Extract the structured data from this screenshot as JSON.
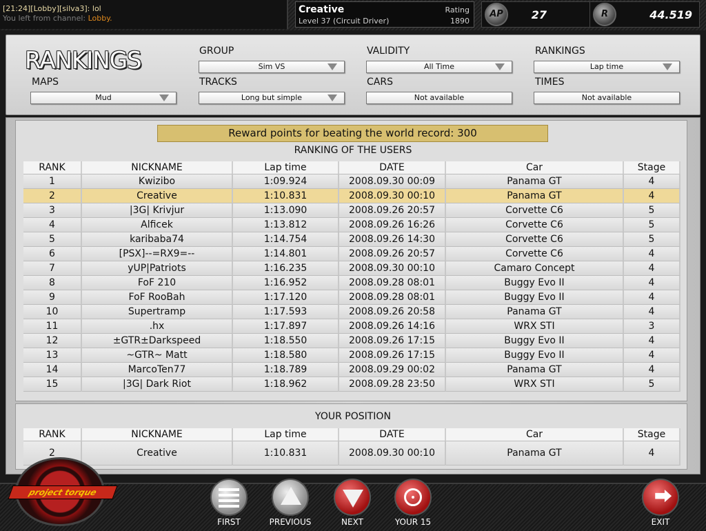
{
  "chat": {
    "line1": "[21:24][Lobby][silva3]: lol",
    "line2_prefix": "You left from channel: ",
    "line2_channel": "Lobby."
  },
  "player": {
    "name": "Creative",
    "level": "Level 37 (Circuit Driver)",
    "rating_label": "Rating",
    "rating_value": "1890"
  },
  "stats": {
    "ap_icon": "ap-coin-icon",
    "ap_label": "AP",
    "ap_value": "27",
    "rp_icon": "rp-coin-icon",
    "rp_label": "R",
    "rp_value": "44.519"
  },
  "page_title": "RANKINGS",
  "filters": {
    "group": {
      "label": "GROUP",
      "value": "Sim VS"
    },
    "validity": {
      "label": "VALIDITY",
      "value": "All Time"
    },
    "rankings": {
      "label": "RANKINGS",
      "value": "Lap time"
    },
    "maps": {
      "label": "MAPS",
      "value": "Mud"
    },
    "tracks": {
      "label": "TRACKS",
      "value": "Long but simple"
    },
    "cars": {
      "label": "CARS",
      "value": "Not available"
    },
    "times": {
      "label": "TIMES",
      "value": "Not available"
    }
  },
  "reward_text": "Reward points for beating the world record: 300",
  "ranking_title": "RANKING OF THE USERS",
  "columns": [
    "RANK",
    "NICKNAME",
    "Lap time",
    "DATE",
    "Car",
    "Stage"
  ],
  "rows": [
    [
      "1",
      "Kwizibo",
      "1:09.924",
      "2008.09.30 00:09",
      "Panama GT",
      "4"
    ],
    [
      "2",
      "Creative",
      "1:10.831",
      "2008.09.30 00:10",
      "Panama GT",
      "4"
    ],
    [
      "3",
      "|3G| Krivjur",
      "1:13.090",
      "2008.09.26 20:57",
      "Corvette C6",
      "5"
    ],
    [
      "4",
      "Alficek",
      "1:13.812",
      "2008.09.26 16:26",
      "Corvette C6",
      "5"
    ],
    [
      "5",
      "karibaba74",
      "1:14.754",
      "2008.09.26 14:30",
      "Corvette C6",
      "5"
    ],
    [
      "6",
      "[PSX]--=RX9=--",
      "1:14.801",
      "2008.09.26 20:57",
      "Corvette C6",
      "4"
    ],
    [
      "7",
      "yUP|Patriots",
      "1:16.235",
      "2008.09.30 00:10",
      "Camaro Concept",
      "4"
    ],
    [
      "8",
      "FoF 210",
      "1:16.952",
      "2008.09.28 08:01",
      "Buggy Evo II",
      "4"
    ],
    [
      "9",
      "FoF RooBah",
      "1:17.120",
      "2008.09.28 08:01",
      "Buggy Evo II",
      "4"
    ],
    [
      "10",
      "Supertramp",
      "1:17.593",
      "2008.09.26 20:58",
      "Panama GT",
      "4"
    ],
    [
      "11",
      ".hx",
      "1:17.897",
      "2008.09.26 14:16",
      "WRX STI",
      "3"
    ],
    [
      "12",
      "±GTR±Darkspeed",
      "1:18.550",
      "2008.09.26 17:15",
      "Buggy Evo II",
      "4"
    ],
    [
      "13",
      "~GTR~ Matt",
      "1:18.580",
      "2008.09.26 17:15",
      "Buggy Evo II",
      "4"
    ],
    [
      "14",
      "MarcoTen77",
      "1:18.789",
      "2008.09.29 00:02",
      "Panama GT",
      "4"
    ],
    [
      "15",
      "|3G| Dark Riot",
      "1:18.962",
      "2008.09.28 23:50",
      "WRX STI",
      "5"
    ]
  ],
  "highlight_row": 1,
  "your_position_title": "YOUR POSITION",
  "your_position": [
    "2",
    "Creative",
    "1:10.831",
    "2008.09.30 00:10",
    "Panama GT",
    "4"
  ],
  "logo_text": "project torque",
  "nav": {
    "first": "FIRST",
    "previous": "PREVIOUS",
    "next": "NEXT",
    "your15": "YOUR 15",
    "exit": "EXIT"
  },
  "colors": {
    "highlight": "#efd999",
    "reward_bg": "#d7bf70",
    "chat_channel": "#e08a1e"
  }
}
